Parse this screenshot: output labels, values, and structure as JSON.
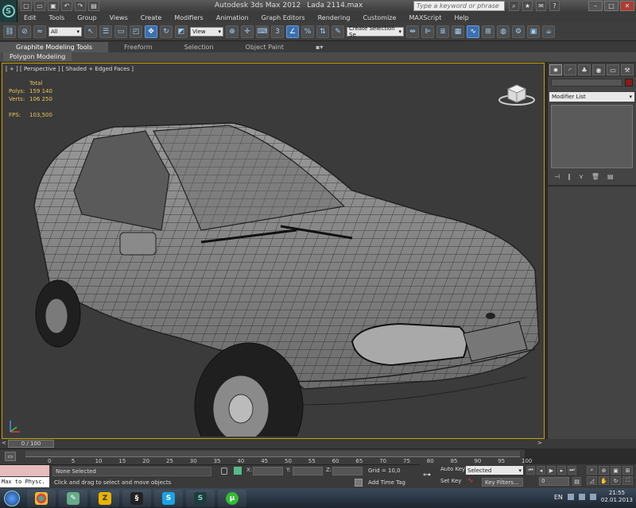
{
  "window": {
    "app_name": "Autodesk 3ds Max  2012",
    "file_name": "Lada 2114.max",
    "search_placeholder": "Type a keyword or phrase"
  },
  "menu": [
    "Edit",
    "Tools",
    "Group",
    "Views",
    "Create",
    "Modifiers",
    "Animation",
    "Graph Editors",
    "Rendering",
    "Customize",
    "MAXScript",
    "Help"
  ],
  "toolbar": {
    "selection_filter": "All",
    "ref_coord": "View",
    "named_selection": "Create Selection Se"
  },
  "ribbon": {
    "tabs": [
      "Graphite Modeling Tools",
      "Freeform",
      "Selection",
      "Object Paint"
    ],
    "active_tab": "Graphite Modeling Tools",
    "sub_panel": "Polygon Modeling"
  },
  "viewport": {
    "label": "[ + ] [ Perspective ] [ Shaded + Edged Faces ]",
    "stats_header": "Total",
    "stats": [
      {
        "key": "Polys:",
        "value": "159 140"
      },
      {
        "key": "Verts:",
        "value": "106 250"
      }
    ],
    "fps_key": "FPS:",
    "fps_value": "103,500"
  },
  "command_panel": {
    "modifier_list": "Modifier List"
  },
  "timeline": {
    "frame_label": "0 / 100",
    "ticks": [
      "0",
      "5",
      "10",
      "15",
      "20",
      "25",
      "30",
      "35",
      "40",
      "45",
      "50",
      "55",
      "60",
      "65",
      "70",
      "75",
      "80",
      "85",
      "90",
      "95",
      "100"
    ]
  },
  "status": {
    "listener_text": "Max to Physc.",
    "selection": "None Selected",
    "prompt": "Click and drag to select and move objects",
    "x_label": "X:",
    "y_label": "Y:",
    "z_label": "Z:",
    "grid": "Grid = 10,0",
    "add_time_tag": "Add Time Tag"
  },
  "anim": {
    "auto_key": "Auto Key",
    "set_key": "Set Key",
    "selected": "Selected",
    "key_filters": "Key Filters...",
    "frame": "0"
  },
  "taskbar": {
    "lang": "EN",
    "time": "21:55",
    "date": "02.01.2013"
  },
  "colors": {
    "viewport_border": "#c8a000",
    "stats_text": "#e6c35c",
    "object_color": "#8b1a1a"
  }
}
